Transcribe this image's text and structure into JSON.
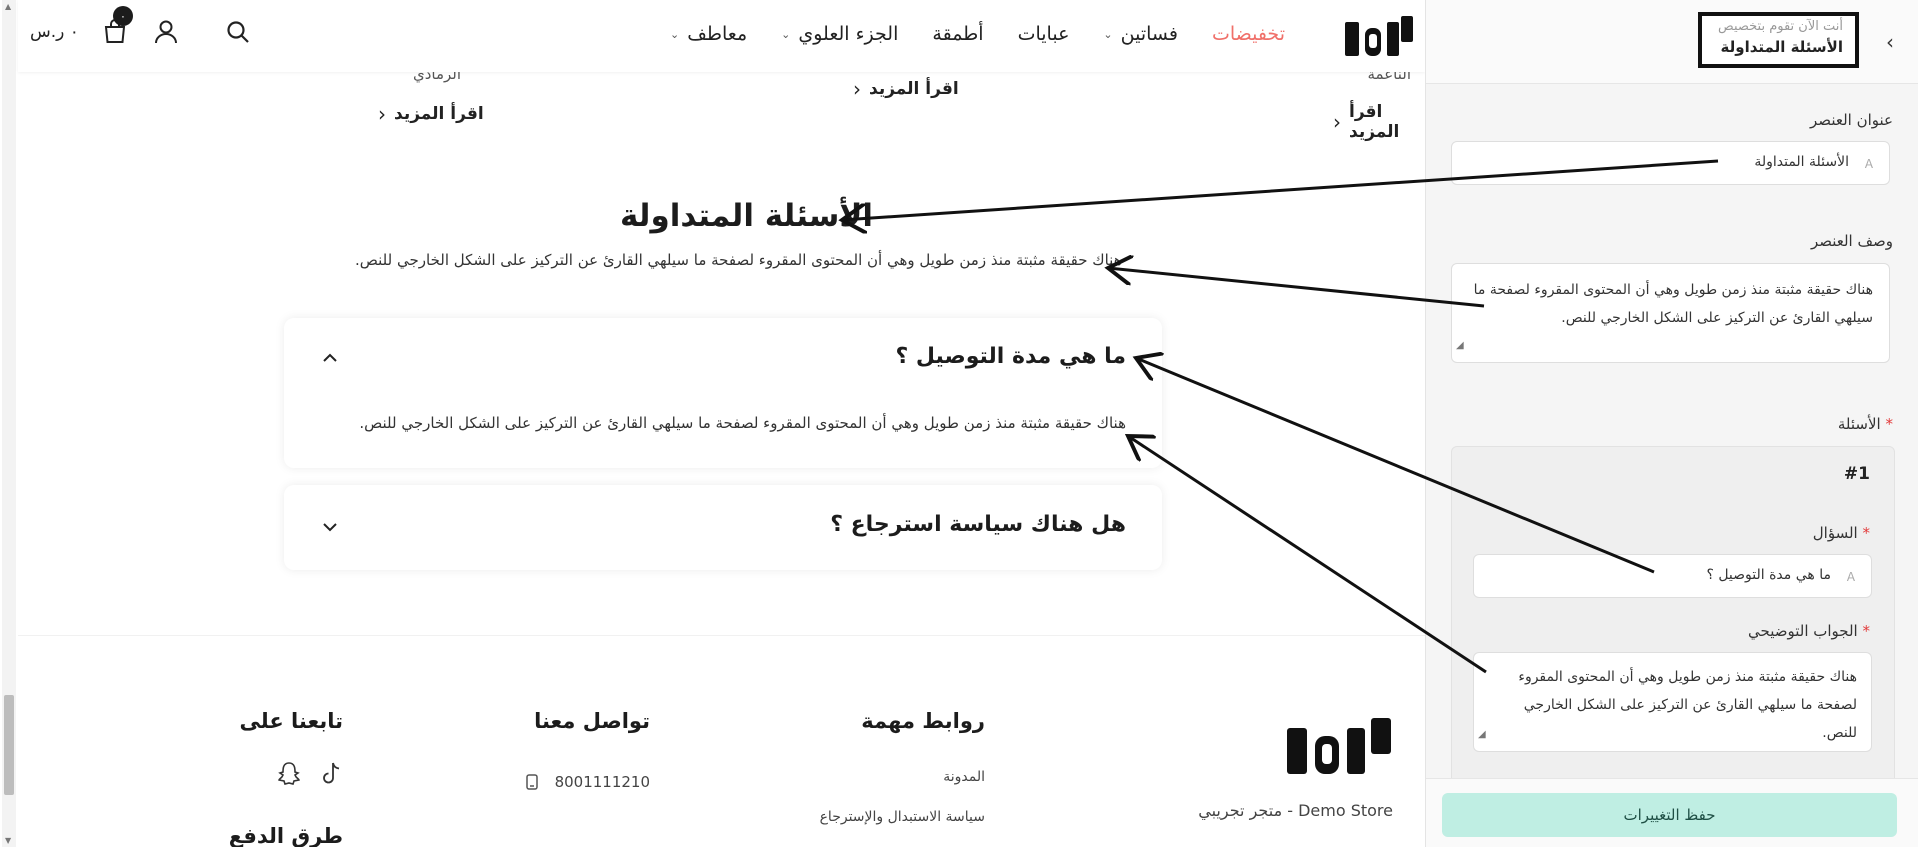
{
  "header": {
    "nav": [
      {
        "label": "تخفيضات",
        "dropdown": false,
        "sale": true
      },
      {
        "label": "فساتين",
        "dropdown": true,
        "sale": false
      },
      {
        "label": "عبايات",
        "dropdown": false,
        "sale": false
      },
      {
        "label": "أطمقة",
        "dropdown": false,
        "sale": false
      },
      {
        "label": "الجزء العلوي",
        "dropdown": true,
        "sale": false
      },
      {
        "label": "معاطف",
        "dropdown": true,
        "sale": false
      }
    ],
    "cart_count": "٠",
    "currency": "٠ ر.س"
  },
  "cards": {
    "caption_right": "الناعمة",
    "caption_left": "الرمادي",
    "read_more": "اقرأ المزيد"
  },
  "faq": {
    "title": "الأسئلة المتداولة",
    "description": "هناك حقيقة مثبتة منذ زمن طويل وهي أن المحتوى المقروء لصفحة ما سيلهي القارئ عن التركيز على الشكل الخارجي للنص.",
    "items": [
      {
        "question": "ما هي مدة التوصيل ؟",
        "answer": "هناك حقيقة مثبتة منذ زمن طويل وهي أن المحتوى المقروء لصفحة ما سيلهي القارئ عن التركيز على الشكل الخارجي للنص.",
        "expanded": true
      },
      {
        "question": "هل هناك سياسة استرجاع ؟",
        "answer": "",
        "expanded": false
      }
    ]
  },
  "footer": {
    "store_name": "متجر تجريبي - Demo Store",
    "links_title": "روابط مهمة",
    "links": [
      "المدونة",
      "سياسة الاستبدال والإسترجاع"
    ],
    "contact_title": "تواصل معنا",
    "phone": "8001111210",
    "follow_title": "تابعنا على",
    "payment_title": "طرق الدفع"
  },
  "sidebar": {
    "context_hint": "أنت الآن تقوم بتخصيص",
    "context_name": "الأسئلة المتداولة",
    "title_label": "عنوان العنصر",
    "title_value": "الأسئلة المتداولة",
    "desc_label": "وصف العنصر",
    "desc_value": "هناك حقيقة مثبتة منذ زمن طويل وهي أن المحتوى المقروء لصفحة ما سيلهي القارئ عن التركيز على الشكل الخارجي للنص.",
    "questions_label": "الأسئلة",
    "question_number": "#1",
    "question_label": "السؤال",
    "question_value": "ما هي مدة التوصيل ؟",
    "answer_label": "الجواب التوضيحي",
    "answer_value": "هناك حقيقة مثبتة منذ زمن طويل وهي أن المحتوى المقروء لصفحة ما سيلهي القارئ عن التركيز على الشكل الخارجي للنص.",
    "save_label": "حفظ التغييرات"
  },
  "colors": {
    "sale": "#f0706a",
    "save_button": "#bfeee3",
    "required": "#e23b3b"
  }
}
